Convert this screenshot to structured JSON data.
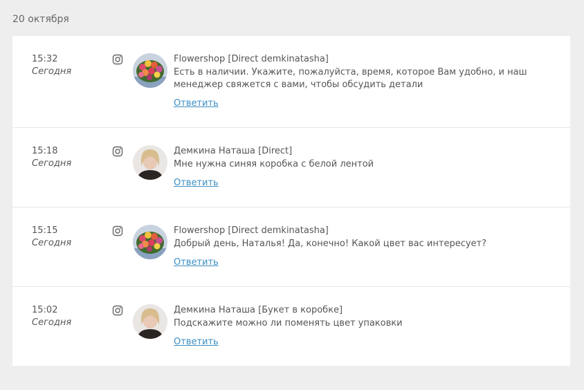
{
  "date_header": "20 октября",
  "entries": [
    {
      "time": "15:32",
      "day": "Сегодня",
      "channel_icon": "instagram-icon",
      "avatar": "flowershop-bouquet",
      "sender": "Flowershop [Direct demkinatasha]",
      "message": "Есть в наличии. Укажите, пожалуйста, время, которое Вам удобно, и наш менеджер свяжется с вами, чтобы обсудить детали",
      "reply_label": "Ответить"
    },
    {
      "time": "15:18",
      "day": "Сегодня",
      "channel_icon": "instagram-icon",
      "avatar": "user-photo-blurred",
      "sender": "Демкина Наташа [Direct]",
      "message": "Мне нужна синяя коробка с белой лентой",
      "reply_label": "Ответить"
    },
    {
      "time": "15:15",
      "day": "Сегодня",
      "channel_icon": "instagram-icon",
      "avatar": "flowershop-bouquet",
      "sender": "Flowershop [Direct demkinatasha]",
      "message": "Добрый день, Наталья! Да, конечно! Какой цвет вас интересует?",
      "reply_label": "Ответить"
    },
    {
      "time": "15:02",
      "day": "Сегодня",
      "channel_icon": "instagram-icon",
      "avatar": "user-photo-blurred",
      "sender": "Демкина Наташа [Букет в коробке]",
      "message": "Подскажите можно ли поменять цвет упаковки",
      "reply_label": "Ответить"
    }
  ],
  "colors": {
    "background": "#eeeeee",
    "card": "#ffffff",
    "text": "#555555",
    "link": "#3b8ec2",
    "divider": "#e6e6e6"
  }
}
